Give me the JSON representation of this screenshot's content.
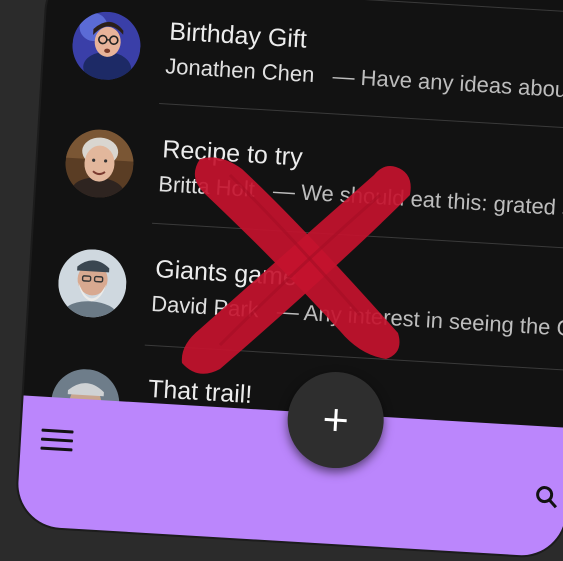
{
  "conversations": [
    {
      "title": "Birthday Gift",
      "sender": "Jonathen Chen",
      "separator": "—",
      "preview": "Have any ideas about what we should get Heidi",
      "avatar_icon": "person-with-glasses-avatar"
    },
    {
      "title": "Recipe to try",
      "sender": "Britta Holt",
      "separator": "—",
      "preview": "We should eat this: grated squash",
      "avatar_icon": "smiling-woman-avatar"
    },
    {
      "title": "Giants game",
      "sender": "David Park",
      "separator": "—",
      "preview": "Any interest in seeing the Giants",
      "avatar_icon": "bearded-man-avatar"
    },
    {
      "title": "That trail!",
      "sender": "",
      "separator": "",
      "preview": "",
      "avatar_icon": "partial-avatar"
    }
  ],
  "bottom_app_bar": {
    "color": "#bb86fc",
    "menu_icon": "hamburger-menu-icon",
    "search_icon": "search-icon"
  },
  "fab": {
    "icon": "plus-icon",
    "color": "#2e2e2e"
  },
  "overlay": {
    "icon": "red-x-cross-icon",
    "color": "#c4122e"
  }
}
